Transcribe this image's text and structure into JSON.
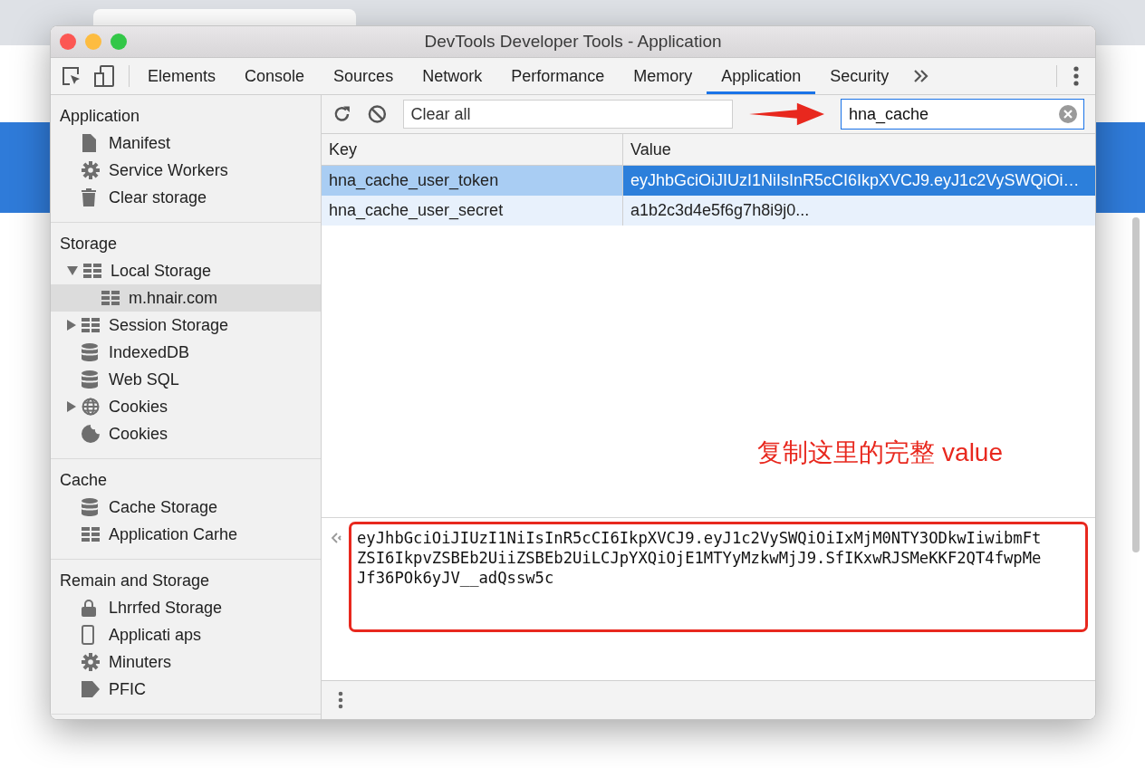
{
  "window": {
    "title": "DevTools Developer Tools - Application"
  },
  "toolbar": {
    "tabs": [
      {
        "label": "Elements",
        "selected": false
      },
      {
        "label": "Console",
        "selected": false
      },
      {
        "label": "Sources",
        "selected": false
      },
      {
        "label": "Network",
        "selected": false
      },
      {
        "label": "Performance",
        "selected": false
      },
      {
        "label": "Memory",
        "selected": false
      },
      {
        "label": "Application",
        "selected": true
      },
      {
        "label": "Security",
        "selected": false
      }
    ]
  },
  "sidebar": {
    "sections": [
      {
        "title": "Application",
        "items": [
          {
            "label": "Manifest",
            "kind": "file",
            "selected": false
          },
          {
            "label": "Service Workers",
            "kind": "gear",
            "selected": false
          },
          {
            "label": "Clear storage",
            "kind": "trash",
            "selected": false
          }
        ]
      },
      {
        "title": "Storage",
        "items": [
          {
            "label": "Local Storage",
            "kind": "grid",
            "selected": false,
            "expanded": true,
            "children": [
              {
                "label": "m.hnair.com",
                "kind": "grid",
                "selected": true
              }
            ]
          },
          {
            "label": "Session Storage",
            "kind": "grid",
            "selected": false,
            "expanded": false
          },
          {
            "label": "IndexedDB",
            "kind": "db",
            "selected": false
          },
          {
            "label": "Web SQL",
            "kind": "db",
            "selected": false
          },
          {
            "label": "Cookies",
            "kind": "globe",
            "selected": false,
            "expanded": false
          },
          {
            "label": "Cookies",
            "kind": "cookie",
            "selected": false
          }
        ]
      },
      {
        "title": "Cache",
        "items": [
          {
            "label": "Cache Storage",
            "kind": "db",
            "selected": false
          },
          {
            "label": "Application Carhe",
            "kind": "grid",
            "selected": false
          }
        ]
      },
      {
        "title": "Remain and Storage",
        "items": [
          {
            "label": "Lhrrfed Storage",
            "kind": "lock",
            "selected": false
          },
          {
            "label": "Applicati aps",
            "kind": "phone",
            "selected": false
          },
          {
            "label": "Minuters",
            "kind": "gear",
            "selected": false
          },
          {
            "label": "PFIC",
            "kind": "tag",
            "selected": false
          }
        ]
      }
    ]
  },
  "filter": {
    "value": "Clear all"
  },
  "search": {
    "value": "hna_cache"
  },
  "table": {
    "columns": [
      "Key",
      "Value"
    ],
    "rows": [
      {
        "key": "hna_cache_user_token",
        "value": "eyJhbGciOiJIUzI1NiIsInR5cCI6IkpXVCJ9.eyJ1c2VySWQiOi…",
        "selected": true
      },
      {
        "key": "hna_cache_user_secret",
        "value": "a1b2c3d4e5f6g7h8i9j0...",
        "selected": false
      }
    ]
  },
  "annotation": {
    "text": "复制这里的完整 value"
  },
  "preview": {
    "value": "eyJhbGciOiJIUzI1NiIsInR5cCI6IkpXVCJ9.eyJ1c2VySWQiOiIxMjM0NTY3ODkwIiwibmFtZSI6IkpvZSBEb2UiiZSBEb2UiLCJpYXQiOjE1MTYyMzkwMjJ9.SfIKxwRJSMeKKF2QT4fwpMeJf36POk6yJV__adQssw5c"
  }
}
